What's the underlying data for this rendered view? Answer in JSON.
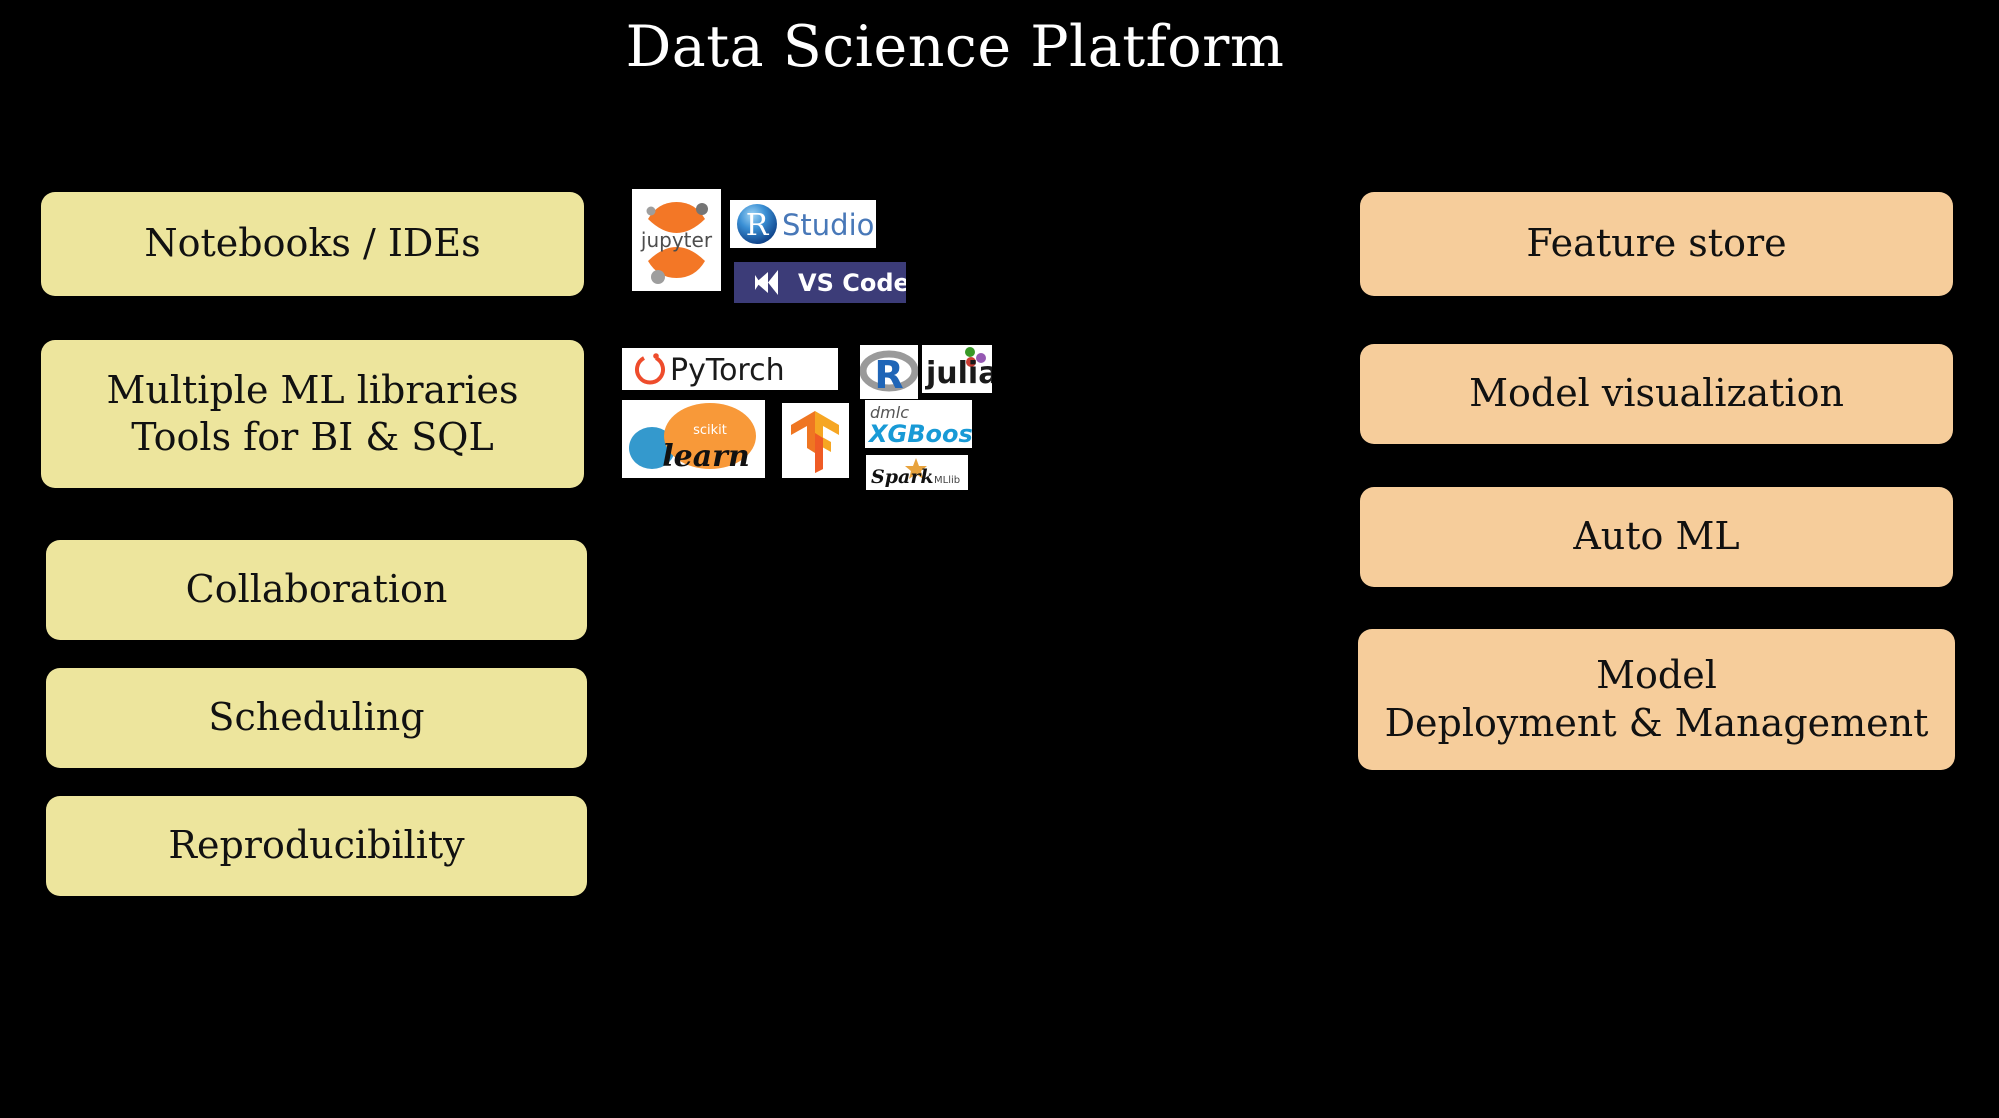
{
  "slide": {
    "title": "Data Science Platform",
    "background_color": "#000000",
    "title_color": "#ffffff"
  },
  "palette": {
    "left_box_fill": "#ede59d",
    "right_box_fill": "#f6cd9b",
    "box_text_color": "#111111",
    "vscode_tile_fill": "#3c3c78",
    "tile_fill": "#ffffff"
  },
  "left_column": {
    "name": "capabilities-left",
    "items": [
      {
        "label": "Notebooks / IDEs",
        "lines": 1
      },
      {
        "label": "Multiple ML libraries\nTools for BI & SQL",
        "lines": 2
      },
      {
        "label": "Collaboration",
        "lines": 1
      },
      {
        "label": "Scheduling",
        "lines": 1
      },
      {
        "label": "Reproducibility",
        "lines": 1
      }
    ]
  },
  "right_column": {
    "name": "capabilities-right",
    "items": [
      {
        "label": "Feature store",
        "lines": 1
      },
      {
        "label": "Model visualization",
        "lines": 1
      },
      {
        "label": "Auto ML",
        "lines": 1
      },
      {
        "label": "Model\nDeployment & Management",
        "lines": 2
      }
    ]
  },
  "center_logos": {
    "name": "tool-logos",
    "rows": [
      {
        "row": "notebooks-ides",
        "tiles": [
          {
            "id": "jupyter",
            "alt": "Jupyter",
            "icon": "jupyter-logo"
          },
          {
            "id": "rstudio",
            "alt": "RStudio",
            "icon": "rstudio-logo"
          },
          {
            "id": "vscode",
            "alt": "VS Code",
            "icon": "vscode-logo"
          }
        ]
      },
      {
        "row": "languages-frameworks",
        "tiles": [
          {
            "id": "pytorch",
            "alt": "PyTorch",
            "icon": "pytorch-logo"
          },
          {
            "id": "rlang",
            "alt": "R",
            "icon": "r-logo"
          },
          {
            "id": "julia",
            "alt": "julia",
            "icon": "julia-logo"
          }
        ]
      },
      {
        "row": "ml-libraries",
        "tiles": [
          {
            "id": "sklearn",
            "alt": "scikit-learn",
            "icon": "scikit-learn-logo"
          },
          {
            "id": "tensorflow",
            "alt": "TensorFlow",
            "icon": "tensorflow-logo"
          },
          {
            "id": "xgboost",
            "alt": "dmlc XGBoost",
            "icon": "xgboost-logo"
          },
          {
            "id": "sparkmllib",
            "alt": "Spark MLlib",
            "icon": "spark-mllib-logo"
          }
        ]
      }
    ],
    "logo_text": {
      "jupyter": "jupyter",
      "rstudio_r": "R",
      "rstudio_studio": "Studio",
      "vscode": "VS Code",
      "pytorch": "PyTorch",
      "r": "R",
      "julia": "julia",
      "scikit": "scikit",
      "learn": "learn",
      "dmlc": "dmlc",
      "xgboost": "XGBoost",
      "spark": "Spark",
      "mllib": "MLlib"
    }
  }
}
